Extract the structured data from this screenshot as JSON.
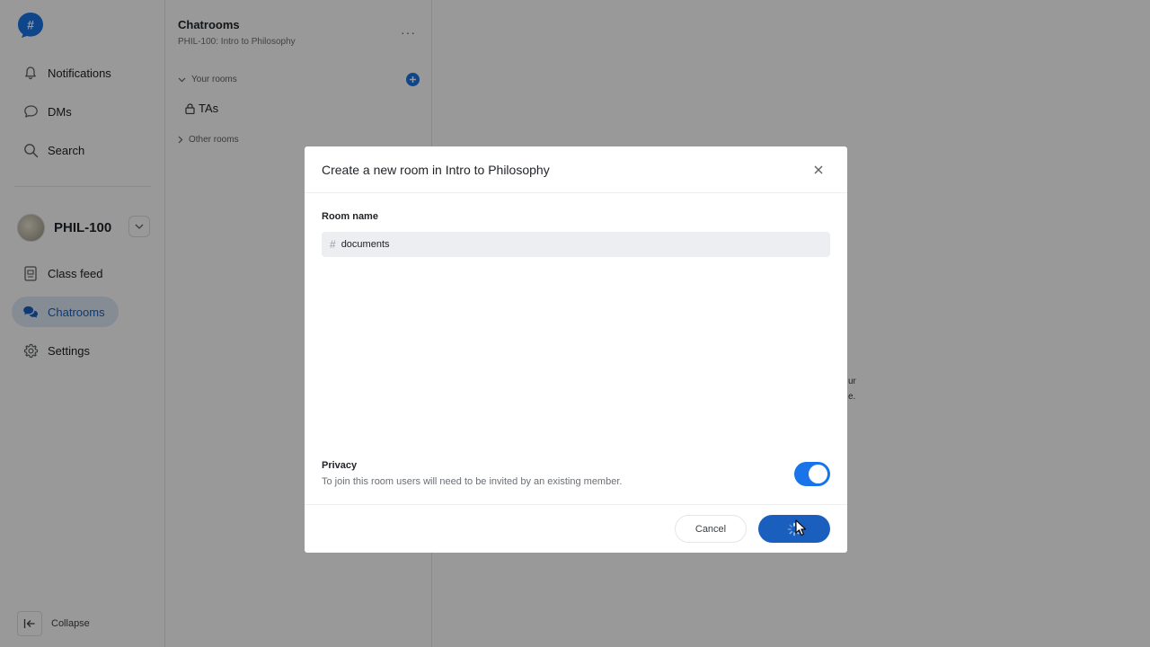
{
  "sidebar": {
    "nav": [
      {
        "label": "Notifications",
        "icon": "bell-icon"
      },
      {
        "label": "DMs",
        "icon": "chat-bubble-icon"
      },
      {
        "label": "Search",
        "icon": "search-icon"
      }
    ],
    "course": {
      "code": "PHIL-100"
    },
    "course_nav": [
      {
        "label": "Class feed",
        "icon": "document-icon"
      },
      {
        "label": "Chatrooms",
        "icon": "chatrooms-icon",
        "active": true
      },
      {
        "label": "Settings",
        "icon": "gear-icon"
      }
    ],
    "collapse_label": "Collapse"
  },
  "panel": {
    "title": "Chatrooms",
    "subtitle": "PHIL-100: Intro to Philosophy",
    "more": "···",
    "your_rooms_label": "Your rooms",
    "rooms": [
      {
        "name": "TAs",
        "private": true
      }
    ],
    "other_rooms_label": "Other rooms"
  },
  "main": {
    "hint_line1": "ur",
    "hint_line2": "e."
  },
  "modal": {
    "title": "Create a new room in Intro to Philosophy",
    "room_name_label": "Room name",
    "room_name_value": "documents",
    "room_name_prefix": "#",
    "privacy_label": "Privacy",
    "privacy_description": "To join this room users will need to be invited by an existing member.",
    "privacy_enabled": true,
    "cancel_label": "Cancel",
    "create_state": "loading"
  },
  "colors": {
    "accent": "#1a73e8",
    "primary_button": "#1a5fbe",
    "active_nav_bg": "#dfe9f7",
    "overlay": "rgba(0,0,0,0.40)"
  }
}
